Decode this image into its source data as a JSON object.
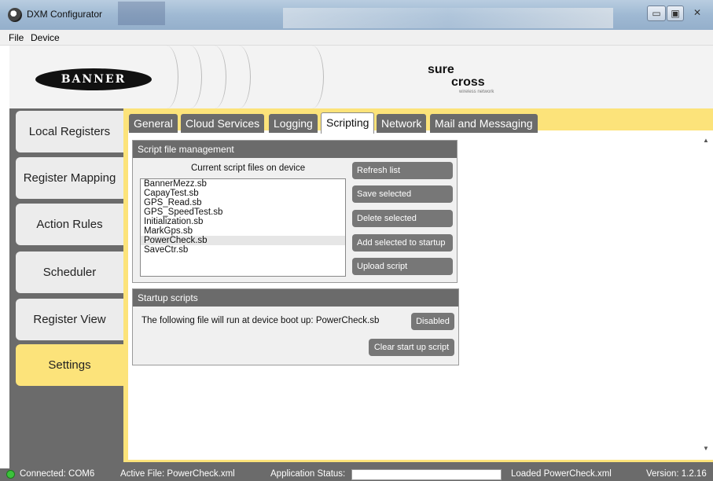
{
  "window": {
    "title": "DXM Configurator",
    "minimize": "▭",
    "maximize": "▣",
    "close": "✕"
  },
  "menu": {
    "file": "File",
    "device": "Device"
  },
  "header": {
    "logo": "BANNER",
    "sure": "sure",
    "cross": "cross",
    "tagline": "wireless network"
  },
  "nav": [
    {
      "label": "Local Registers"
    },
    {
      "label": "Register Mapping"
    },
    {
      "label": "Action Rules"
    },
    {
      "label": "Scheduler"
    },
    {
      "label": "Register View"
    },
    {
      "label": "Settings"
    }
  ],
  "tabs": [
    {
      "label": "General"
    },
    {
      "label": "Cloud Services"
    },
    {
      "label": "Logging"
    },
    {
      "label": "Scripting"
    },
    {
      "label": "Network"
    },
    {
      "label": "Mail and Messaging"
    }
  ],
  "script_mgmt": {
    "title": "Script file management",
    "list_heading": "Current script files on device",
    "files": [
      "BannerMezz.sb",
      "CapayTest.sb",
      "GPS_Read.sb",
      "GPS_SpeedTest.sb",
      "Initialization.sb",
      "MarkGps.sb",
      "PowerCheck.sb",
      "SaveCtr.sb"
    ],
    "selected_file": "PowerCheck.sb",
    "buttons": {
      "refresh": "Refresh list",
      "save": "Save selected",
      "delete": "Delete selected",
      "add_startup": "Add selected to startup",
      "upload": "Upload script"
    }
  },
  "startup": {
    "title": "Startup scripts",
    "text": "The following file will run at device boot up:  PowerCheck.sb",
    "disabled": "Disabled",
    "clear": "Clear start up script"
  },
  "status": {
    "connected": "Connected: COM6",
    "active_file": "Active File: PowerCheck.xml",
    "app_status_label": "Application Status:",
    "app_status_value": "",
    "loaded": "Loaded PowerCheck.xml",
    "version": "Version:  1.2.16"
  },
  "colors": {
    "accent": "#fce37a",
    "frame": "#6b6b6b",
    "button": "#777777",
    "connected": "#3cc23c"
  }
}
